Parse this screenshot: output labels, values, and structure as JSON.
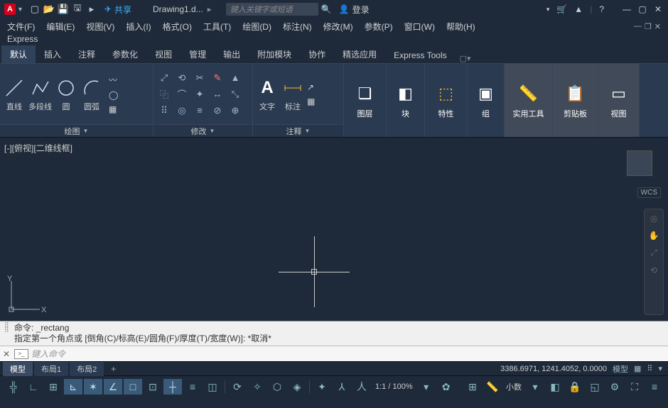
{
  "app": {
    "logo": "A",
    "share": "共享",
    "doc_name": "Drawing1.d...",
    "search_placeholder": "键入关键字或短语",
    "login": "登录"
  },
  "menubar": {
    "items": [
      {
        "label": "文件(F)"
      },
      {
        "label": "编辑(E)"
      },
      {
        "label": "视图(V)"
      },
      {
        "label": "插入(I)"
      },
      {
        "label": "格式(O)"
      },
      {
        "label": "工具(T)"
      },
      {
        "label": "绘图(D)"
      },
      {
        "label": "标注(N)"
      },
      {
        "label": "修改(M)"
      },
      {
        "label": "参数(P)"
      },
      {
        "label": "窗口(W)"
      },
      {
        "label": "帮助(H)"
      }
    ],
    "express": "Express"
  },
  "ribbon_tabs": [
    {
      "label": "默认",
      "active": true
    },
    {
      "label": "插入"
    },
    {
      "label": "注释"
    },
    {
      "label": "参数化"
    },
    {
      "label": "视图"
    },
    {
      "label": "管理"
    },
    {
      "label": "输出"
    },
    {
      "label": "附加模块"
    },
    {
      "label": "协作"
    },
    {
      "label": "精选应用"
    },
    {
      "label": "Express Tools"
    }
  ],
  "ribbon": {
    "draw": {
      "name": "绘图",
      "line": "直线",
      "polyline": "多段线",
      "circle": "圆",
      "arc": "圆弧"
    },
    "modify": {
      "name": "修改"
    },
    "annotation": {
      "name": "注释",
      "text": "文字",
      "dim": "标注",
      "table": "▦"
    },
    "layers": {
      "name": "图层"
    },
    "blocks": {
      "name": "块"
    },
    "properties": {
      "name": "特性"
    },
    "groups": {
      "name": "组"
    },
    "utilities": {
      "name": "实用工具"
    },
    "clipboard": {
      "name": "剪贴板"
    },
    "view": {
      "name": "视图"
    }
  },
  "viewport": {
    "label": "[-][俯视][二维线框]",
    "wcs": "WCS"
  },
  "command": {
    "history_line1": "命令: _rectang",
    "history_line2": "指定第一个角点或 [倒角(C)/标高(E)/圆角(F)/厚度(T)/宽度(W)]: *取消*",
    "prompt_placeholder": "键入命令"
  },
  "model_tabs": {
    "model": "模型",
    "layout1": "布局1",
    "layout2": "布局2"
  },
  "status": {
    "coords": "3386.6971, 1241.4052, 0.0000",
    "model": "模型",
    "zoom": "1:1 / 100%",
    "decimal": "小数"
  }
}
